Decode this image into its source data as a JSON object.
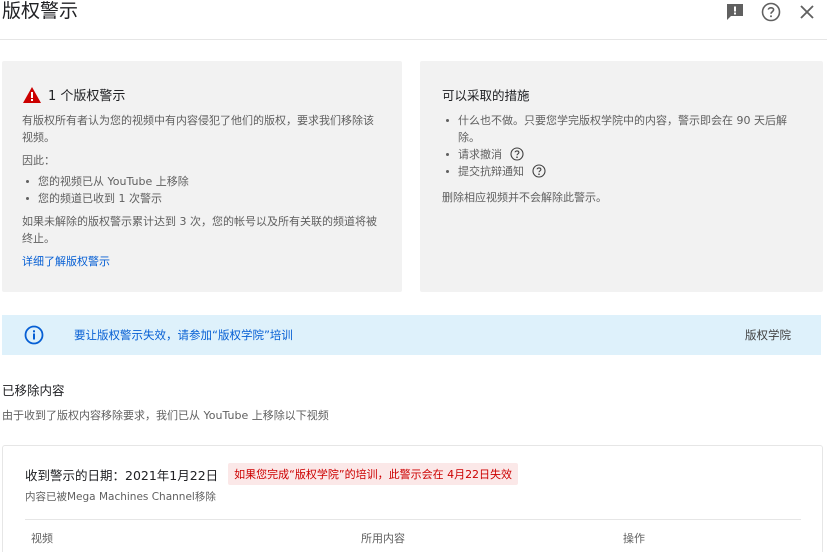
{
  "header": {
    "title": "版权警示"
  },
  "icons": {
    "feedback": "feedback-icon",
    "help": "help-icon",
    "close": "close-icon"
  },
  "strike_card": {
    "title": "1 个版权警示",
    "description": "有版权所有者认为您的视频中有内容侵犯了他们的版权，要求我们移除该视频。",
    "therefore": "因此：",
    "bullets": [
      "您的视频已从 YouTube 上移除",
      "您的频道已收到 1 次警示"
    ],
    "warning": "如果未解除的版权警示累计达到 3 次，您的帐号以及所有关联的频道将被终止。",
    "learn_more": "详细了解版权警示"
  },
  "actions_card": {
    "title": "可以采取的措施",
    "bullets": [
      "什么也不做。只要您学完版权学院中的内容，警示即会在 90 天后解除。",
      "请求撤消",
      "提交抗辩通知"
    ],
    "note": "删除相应视频并不会解除此警示。"
  },
  "banner": {
    "text": "要让版权警示失效，请参加“版权学院”培训",
    "link": "版权学院"
  },
  "removed_section": {
    "title": "已移除内容",
    "subtitle": "由于收到了版权内容移除要求，我们已从 YouTube 上移除以下视频"
  },
  "removed_card": {
    "date_label": "收到警示的日期：2021年1月22日",
    "badge": "如果您完成“版权学院”的培训，此警示会在 4月22日失效",
    "removed_by": "内容已被Mega Machines Channel移除",
    "columns": [
      "视频",
      "所用内容",
      "操作"
    ]
  },
  "colors": {
    "accent": "#065fd4",
    "warning_red": "#cc0000",
    "card_bg": "#f2f2f2",
    "banner_bg": "#def1fb"
  }
}
